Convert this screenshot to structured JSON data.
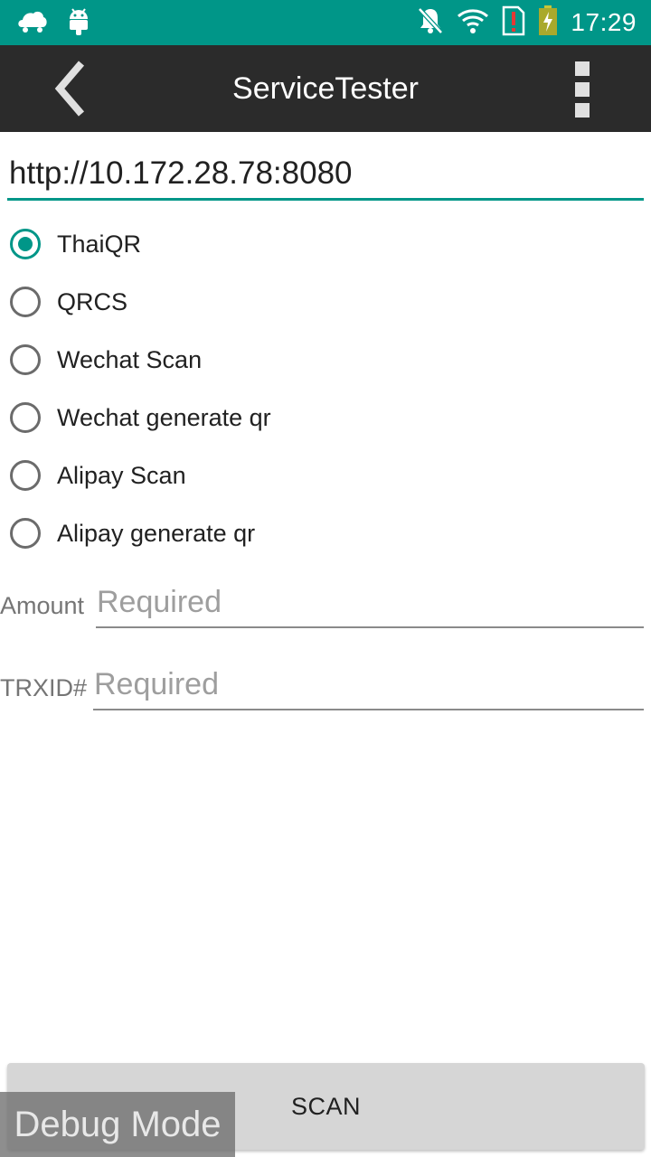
{
  "status_bar": {
    "time": "17:29",
    "background": "#009688",
    "icons_left": [
      "cloud-notification-icon",
      "android-icon"
    ],
    "icons_right": [
      "notifications-off-icon",
      "wifi-icon",
      "sim-alert-icon",
      "battery-charging-icon"
    ]
  },
  "app_bar": {
    "title": "ServiceTester",
    "background": "#2b2b2b",
    "back_icon": "chevron-left-icon",
    "menu_icon": "overflow-menu-icon"
  },
  "url_input": {
    "value": "http://10.172.28.78:8080",
    "accent": "#009688"
  },
  "modes": {
    "options": [
      {
        "label": "ThaiQR",
        "checked": true
      },
      {
        "label": "QRCS",
        "checked": false
      },
      {
        "label": "Wechat Scan",
        "checked": false
      },
      {
        "label": "Wechat generate qr",
        "checked": false
      },
      {
        "label": "Alipay Scan",
        "checked": false
      },
      {
        "label": "Alipay generate qr",
        "checked": false
      }
    ]
  },
  "form": {
    "amount_label": "Amount",
    "amount_placeholder": "Required",
    "trxid_label": "TRXID#",
    "trxid_placeholder": "Required"
  },
  "scan_button": {
    "label": "SCAN"
  },
  "debug_overlay": {
    "text": "Debug Mode"
  }
}
